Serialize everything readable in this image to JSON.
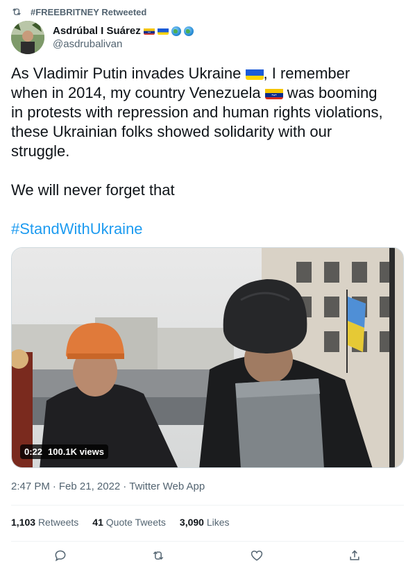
{
  "retweet_banner": {
    "icon": "retweet-icon",
    "text": "#FREEBRITNEY Retweeted"
  },
  "author": {
    "name": "Asdrúbal I Suárez",
    "handle": "@asdrubalivan",
    "badges": [
      "venezuela-flag-icon",
      "ukraine-flag-icon",
      "globe-icon",
      "globe-icon"
    ]
  },
  "tweet": {
    "line1_a": "As Vladimir Putin invades Ukraine",
    "line1_b": ", I remember",
    "line2_a": "when in 2014, my country Venezuela",
    "line2_b": " was booming",
    "line3": "in protests with repression and human rights violations,",
    "line4": "these Ukrainian folks showed solidarity with our",
    "line5": "struggle.",
    "para2": "We will never forget that",
    "hashtag": "#StandWithUkraine"
  },
  "video": {
    "duration": "0:22",
    "views": "100.1K views"
  },
  "meta": {
    "time": "2:47 PM",
    "sep": "·",
    "date": "Feb 21, 2022",
    "sep2": "·",
    "source": "Twitter Web App"
  },
  "stats": {
    "retweets_count": "1,103",
    "retweets_label": "Retweets",
    "quotes_count": "41",
    "quotes_label": "Quote Tweets",
    "likes_count": "3,090",
    "likes_label": "Likes"
  },
  "actions": [
    "reply-icon",
    "retweet-icon",
    "like-icon",
    "share-icon"
  ],
  "colors": {
    "accent": "#1d9bf0",
    "text": "#0f1419",
    "secondary": "#536471",
    "divider": "#eff3f4"
  }
}
